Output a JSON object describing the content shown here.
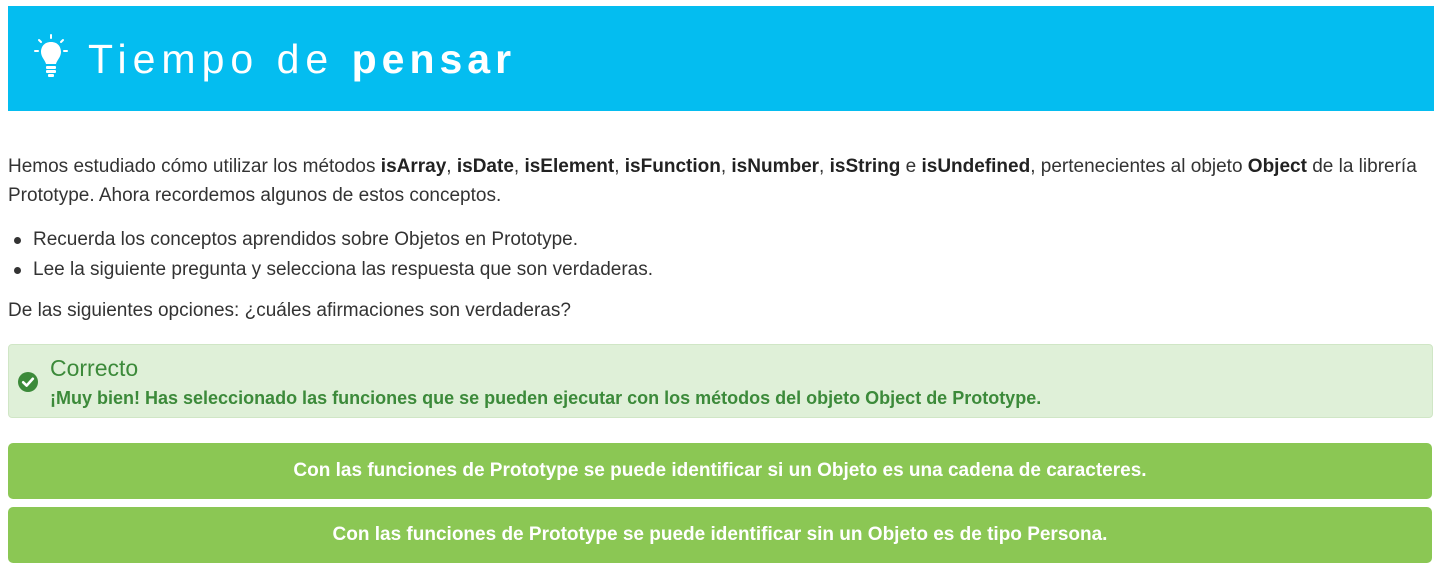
{
  "header": {
    "title_light": "Tiempo de",
    "title_bold": "pensar",
    "icon": "lightbulb-icon",
    "background": "#04bdf0"
  },
  "intro": {
    "t1": "Hemos estudiado cómo utilizar los métodos ",
    "m1": "isArray",
    "s1": ", ",
    "m2": "isDate",
    "s2": ", ",
    "m3": "isElement",
    "s3": ", ",
    "m4": "isFunction",
    "s4": ", ",
    "m5": "isNumber",
    "s5": ", ",
    "m6": "isString",
    "s6": " e ",
    "m7": "isUndefined",
    "t2": ", pertenecientes al objeto ",
    "obj": "Object",
    "t3": " de la librería Prototype. Ahora recordemos algunos de estos conceptos."
  },
  "bullets": [
    "Recuerda los conceptos aprendidos sobre Objetos en Prototype.",
    "Lee la siguiente pregunta y selecciona las respuesta que son verdaderas."
  ],
  "question": "De las  siguientes opciones: ¿cuáles afirmaciones son verdaderas?",
  "feedback": {
    "icon": "check-circle-icon",
    "title": "Correcto",
    "message": "¡Muy bien! Has seleccionado las funciones que se pueden ejecutar con los métodos del objeto Object de Prototype.",
    "color": "#3c8a3a",
    "background": "#dff0d8"
  },
  "options": [
    "Con las funciones de Prototype se puede identificar si un Objeto es una cadena de caracteres.",
    "Con las funciones de Prototype se puede identificar sin un Objeto es de tipo Persona."
  ],
  "colors": {
    "option_selected": "#8bc754"
  }
}
